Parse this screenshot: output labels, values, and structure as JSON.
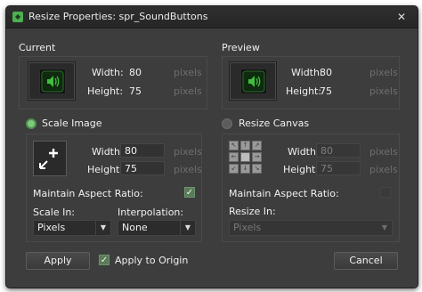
{
  "window": {
    "title": "Resize Properties: spr_SoundButtons",
    "close_glyph": "✕"
  },
  "current": {
    "section_title": "Current",
    "width_label": "Width:",
    "width_value": "80",
    "height_label": "Height:",
    "height_value": "75",
    "unit": "pixels"
  },
  "preview": {
    "section_title": "Preview",
    "width_label": "Width:",
    "width_value": "80",
    "height_label": "Height:",
    "height_value": "75",
    "unit": "pixels"
  },
  "scale_image": {
    "option_label": "Scale Image",
    "selected": true,
    "width_label": "Width:",
    "width_value": "80",
    "height_label": "Height:",
    "height_value": "75",
    "unit": "pixels",
    "maintain_aspect_label": "Maintain Aspect Ratio:",
    "maintain_aspect_checked": true,
    "scale_in_label": "Scale In:",
    "scale_in_value": "Pixels",
    "interpolation_label": "Interpolation:",
    "interpolation_value": "None"
  },
  "resize_canvas": {
    "option_label": "Resize Canvas",
    "selected": false,
    "width_label": "Width:",
    "width_value": "80",
    "height_label": "Height:",
    "height_value": "75",
    "unit": "pixels",
    "maintain_aspect_label": "Maintain Aspect Ratio:",
    "resize_in_label": "Resize In:",
    "resize_in_value": "Pixels"
  },
  "footer": {
    "apply_label": "Apply",
    "apply_to_origin_label": "Apply to Origin",
    "apply_to_origin_checked": true,
    "cancel_label": "Cancel"
  },
  "colors": {
    "accent_green": "#7ecb7e",
    "speaker_green": "#3fbf3f",
    "window_bg": "#3d3d3d"
  }
}
